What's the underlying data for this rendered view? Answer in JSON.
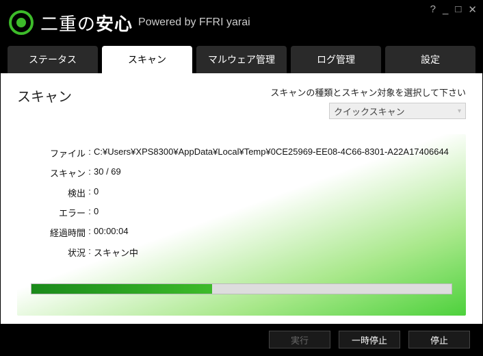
{
  "app": {
    "title_prefix": "二重の",
    "title_bold": "安心",
    "powered": "Powered by FFRI yarai"
  },
  "window_controls": {
    "help": "?",
    "minimize": "_",
    "maximize": "□",
    "close": "✕"
  },
  "tabs": {
    "status": "ステータス",
    "scan": "スキャン",
    "malware": "マルウェア管理",
    "log": "ログ管理",
    "settings": "設定",
    "active_index": 1
  },
  "page": {
    "title": "スキャン",
    "instruction": "スキャンの種類とスキャン対象を選択して下さい",
    "scan_type_selected": "クイックスキャン"
  },
  "scan_info": {
    "labels": {
      "file": "ファイル",
      "scan": "スキャン",
      "detect": "検出",
      "error": "エラー",
      "elapsed": "経過時間",
      "status": "状況"
    },
    "values": {
      "file": "C:¥Users¥XPS8300¥AppData¥Local¥Temp¥0CE25969-EE08-4C66-8301-A22A17406644",
      "scan": "30 / 69",
      "detect": "0",
      "error": "0",
      "elapsed": "00:00:04",
      "status": "スキャン中"
    },
    "progress_percent": 43
  },
  "buttons": {
    "execute": "実行",
    "pause": "一時停止",
    "stop": "停止"
  },
  "colors": {
    "accent": "#3dbb2a"
  }
}
